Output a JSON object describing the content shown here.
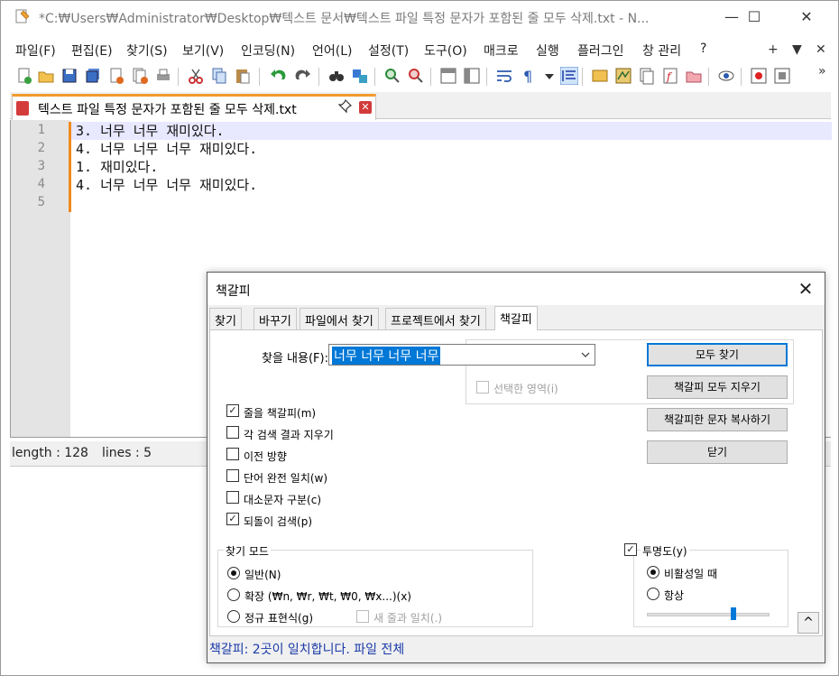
{
  "window": {
    "title": "*C:₩Users₩Administrator₩Desktop₩텍스트 문서₩텍스트 파일 특정 문자가 포함된 줄 모두 삭제.txt - N...",
    "minimize": "—",
    "maximize": "☐",
    "close": "✕"
  },
  "menu": {
    "items": [
      "파일(F)",
      "편집(E)",
      "찾기(S)",
      "보기(V)",
      "인코딩(N)",
      "언어(L)",
      "설정(T)",
      "도구(O)",
      "매크로",
      "실행",
      "플러그인",
      "창 관리",
      "?"
    ],
    "right_plus": "+",
    "right_down": "▼",
    "right_close": "✕",
    "right_scroll": "»"
  },
  "tab": {
    "label": "텍스트 파일 특정 문자가 포함된 줄 모두 삭제.txt",
    "close": "✕"
  },
  "editor": {
    "lines": [
      {
        "num": "1",
        "text": "3. 너무 너무 재미있다."
      },
      {
        "num": "2",
        "text": "4. 너무 너무 너무 재미있다."
      },
      {
        "num": "3",
        "text": "1. 재미있다."
      },
      {
        "num": "4",
        "text": "4. 너무 너무 너무 재미있다."
      },
      {
        "num": "5",
        "text": ""
      }
    ]
  },
  "status": {
    "length": "length : 128",
    "lines": "lines : 5"
  },
  "dialog": {
    "title": "책갈피",
    "close": "✕",
    "tabs": [
      "찾기",
      "바꾸기",
      "파일에서 찾기",
      "프로젝트에서 찾기",
      "책갈피"
    ],
    "active_tab": "책갈피",
    "find_label": "찾을 내용(F):",
    "find_value": "너무 너무 너무 너무",
    "in_selection": "선택한 영역(i)",
    "buttons": {
      "find_all": "모두 찾기",
      "clear_marks": "책갈피 모두 지우기",
      "copy_marked": "책갈피한 문자 복사하기",
      "close": "닫기"
    },
    "options": [
      {
        "label": "줄을 책갈피(m)",
        "checked": true
      },
      {
        "label": "각 검색 결과 지우기",
        "checked": false
      },
      {
        "label": "이전 방향",
        "checked": false
      },
      {
        "label": "단어 완전 일치(w)",
        "checked": false
      },
      {
        "label": "대소문자 구분(c)",
        "checked": false
      },
      {
        "label": "되돌이 검색(p)",
        "checked": true
      }
    ],
    "search_mode": {
      "title": "찾기 모드",
      "normal": "일반(N)",
      "extended": "확장 (₩n, ₩r, ₩t, ₩0, ₩x...)(x)",
      "regex": "정규 표현식(g)",
      "dot_newline": "새 줄과 일치(.)",
      "selected": "일반(N)"
    },
    "transparency": {
      "label": "투명도(y)",
      "enabled": true,
      "on_lose_focus": "비활성일 때",
      "always": "항상",
      "selected": "비활성일 때"
    },
    "collapse": "^",
    "status": "책갈피: 2곳이 일치합니다. 파일 전체"
  },
  "colors": {
    "accent": "#0078d7",
    "change_marker": "#f08a1e",
    "status_text": "#1a3aa8"
  }
}
